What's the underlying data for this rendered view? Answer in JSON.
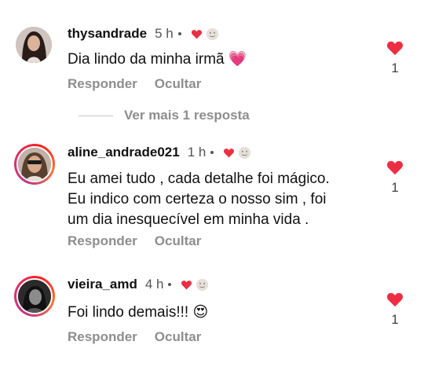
{
  "comments": [
    {
      "username": "thysandrade",
      "time": "5 h",
      "text_lines": [
        "Dia lindo da minha irmã 💗"
      ],
      "reply_label": "Responder",
      "hide_label": "Ocultar",
      "like_count": "1"
    },
    {
      "username": "aline_andrade021",
      "time": "1 h",
      "text_lines": [
        "Eu amei tudo , cada detalhe foi mágico.",
        "Eu indico com certeza o nosso sim , foi",
        "um dia inesquecível em minha vida ."
      ],
      "reply_label": "Responder",
      "hide_label": "Ocultar",
      "like_count": "1"
    },
    {
      "username": "vieira_amd",
      "time": "4 h",
      "text_lines": [
        "Foi lindo demais!!! 😍"
      ],
      "reply_label": "Responder",
      "hide_label": "Ocultar",
      "like_count": "1"
    }
  ],
  "more_replies_label": "Ver mais 1 resposta",
  "colors": {
    "like_red": "#ed2e42",
    "muted": "#8e8e8e"
  },
  "icons": {
    "like": "heart-icon",
    "author_liked": "heart-icon",
    "author_badge": "face-icon"
  }
}
